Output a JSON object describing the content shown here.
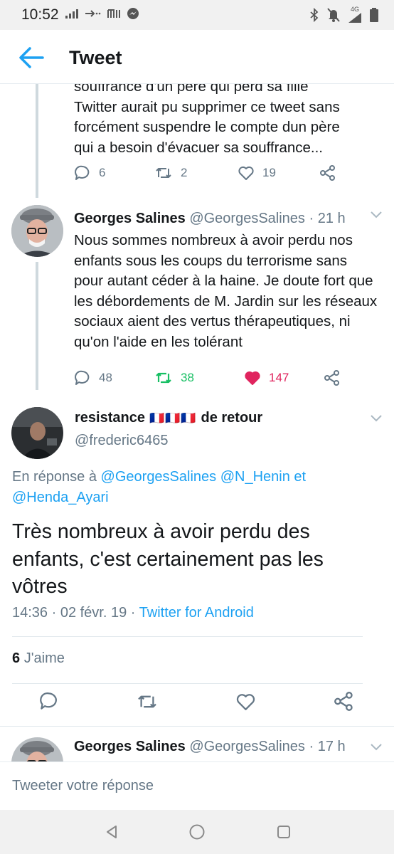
{
  "status_bar": {
    "time": "10:52",
    "left_icons": [
      "signal-icon",
      "data-arrows-icon",
      "news-app-icon",
      "messenger-icon"
    ],
    "right_icons": [
      "bluetooth-icon",
      "mute-icon",
      "network-4g-icon",
      "battery-icon"
    ],
    "network_label": "4G"
  },
  "header": {
    "title": "Tweet",
    "back_icon": "arrow-left-icon",
    "accent": "#1da1f2"
  },
  "tweets": [
    {
      "text_lines": [
        "souffrance d'un père qui perd sa fille",
        "Twitter aurait pu supprimer ce tweet sans",
        "forcément suspendre le compte dun père",
        "qui a besoin d'évacuer sa souffrance..."
      ],
      "reply_count": "6",
      "retweet_count": "2",
      "like_count": "19"
    },
    {
      "name": "Georges Salines",
      "handle": "@GeorgesSalines",
      "time": "· 21 h",
      "text": "Nous sommes nombreux à avoir perdu nos enfants sous les coups du terrorisme sans pour autant céder à la haine. Je doute fort que les débordements de M. Jardin sur les réseaux sociaux aient des vertus thérapeutiques, ni qu'on l'aide en les tolérant",
      "reply_count": "48",
      "retweet_count": "38",
      "like_count": "147",
      "retweeted": true,
      "liked": true,
      "retweet_color": "#17bf63",
      "like_color": "#e0245e"
    }
  ],
  "focused_tweet": {
    "name": "resistance",
    "flags": "🇫🇷🇫🇷🇫🇷",
    "name_suffix": "de retour",
    "handle": "@frederic6465",
    "reply_to_prefix": "En réponse à",
    "reply_to_line1": "@GeorgesSalines @N_Henin et",
    "reply_to_line2": "@Henda_Ayari",
    "text": "Très nombreux à avoir perdu des enfants, c'est certainement pas les vôtres",
    "date": "14:36 · 02 févr. 19 ·",
    "source": "Twitter for Android",
    "likes_count": "6",
    "likes_label": "J'aime"
  },
  "next_tweet": {
    "name": "Georges Salines",
    "handle": "@GeorgesSalines",
    "time": "· 17 h"
  },
  "reply_bar": {
    "placeholder": "Tweeter votre réponse"
  },
  "nav_bar": {
    "icons": [
      "back-triangle-icon",
      "home-circle-icon",
      "recents-square-icon"
    ]
  }
}
